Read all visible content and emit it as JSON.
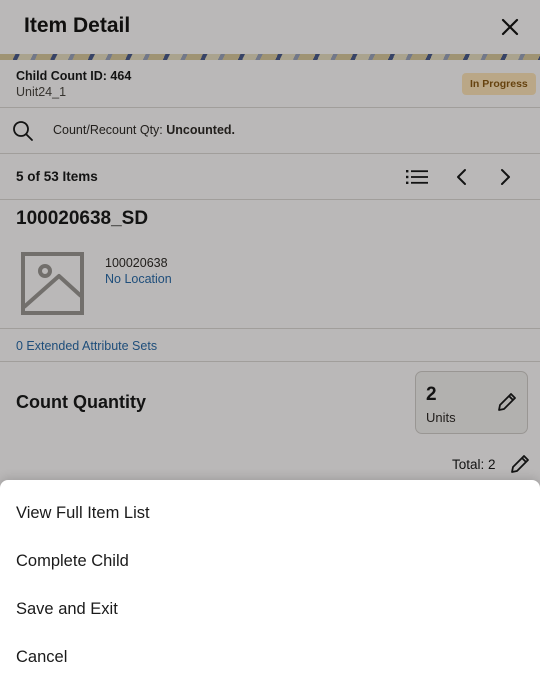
{
  "header": {
    "title": "Item Detail"
  },
  "context": {
    "child_count_label": "Child Count ID: 464",
    "unit": "Unit24_1",
    "status": "In Progress"
  },
  "search": {
    "label": "Count/Recount Qty: ",
    "value": "Uncounted."
  },
  "pager": {
    "label": "5 of 53 Items"
  },
  "item": {
    "title": "100020638_SD",
    "number": "100020638",
    "location": "No Location"
  },
  "extended_attributes": "0 Extended Attribute Sets",
  "count": {
    "title": "Count Quantity",
    "quantity": "2",
    "uom": "Units",
    "total_label": "Total: 2"
  },
  "actions": {
    "view_full_list": "View Full Item List",
    "complete_child": "Complete Child",
    "save_exit": "Save and Exit",
    "cancel": "Cancel"
  },
  "colors": {
    "status_badge_bg": "#fbe2b7",
    "status_badge_text": "#8a5a14",
    "link": "#2b6aa6"
  }
}
